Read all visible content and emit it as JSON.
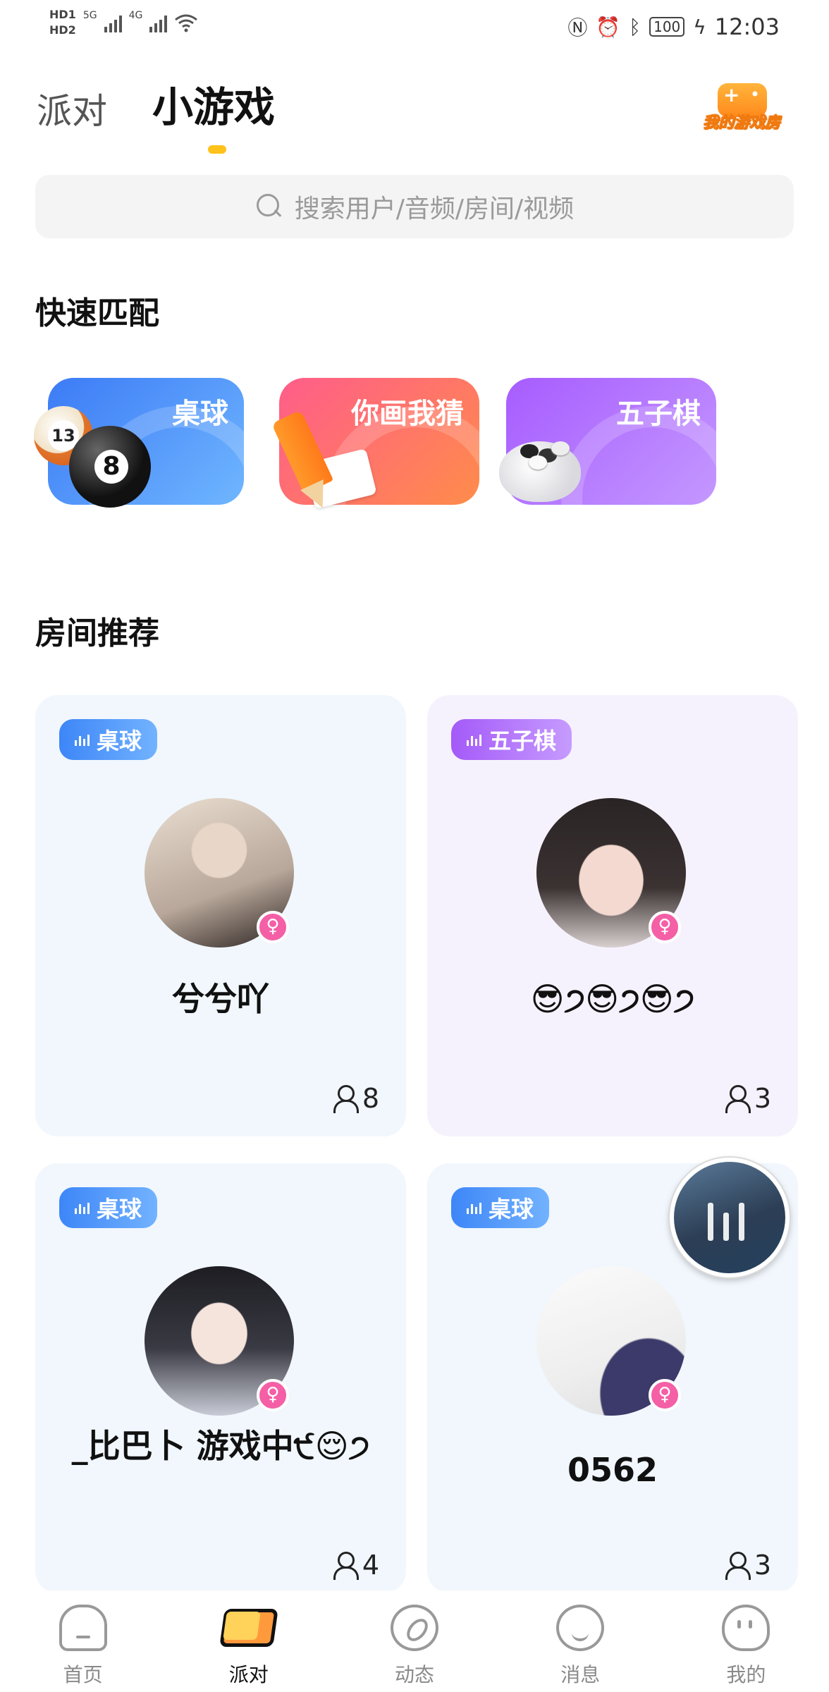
{
  "status_bar": {
    "hd1": "HD1",
    "hd2": "HD2",
    "net1": "5G",
    "net2": "4G",
    "battery": "100",
    "time": "12:03"
  },
  "header": {
    "tabs": [
      {
        "label": "派对",
        "active": false
      },
      {
        "label": "小游戏",
        "active": true
      }
    ],
    "game_room_label": "我的游戏房"
  },
  "search": {
    "placeholder": "搜索用户/音频/房间/视频"
  },
  "quick_match": {
    "title": "快速匹配",
    "items": [
      {
        "label": "桌球",
        "icon": "billiard-balls-icon"
      },
      {
        "label": "你画我猜",
        "icon": "pencil-drawing-icon"
      },
      {
        "label": "五子棋",
        "icon": "gomoku-stones-icon"
      }
    ]
  },
  "rooms": {
    "title": "房间推荐",
    "items": [
      {
        "tag": "桌球",
        "name": "兮兮吖",
        "count": "8",
        "gender": "♀"
      },
      {
        "tag": "五子棋",
        "name": "😎੭😎੭😎੭",
        "count": "3",
        "gender": "♀"
      },
      {
        "tag": "桌球",
        "name": "_比巴卜 游戏中੯😌੭",
        "count": "4",
        "gender": "♀"
      },
      {
        "tag": "桌球",
        "name": "0562",
        "count": "3",
        "gender": "♀"
      }
    ]
  },
  "bottom_nav": {
    "items": [
      {
        "label": "首页",
        "active": false
      },
      {
        "label": "派对",
        "active": true
      },
      {
        "label": "动态",
        "active": false
      },
      {
        "label": "消息",
        "active": false
      },
      {
        "label": "我的",
        "active": false
      }
    ]
  },
  "colors": {
    "accent_yellow": "#ffc21a",
    "tag_blue": "#3d86f7",
    "tag_purple": "#a45af8",
    "gender_pink": "#f45fa6"
  }
}
